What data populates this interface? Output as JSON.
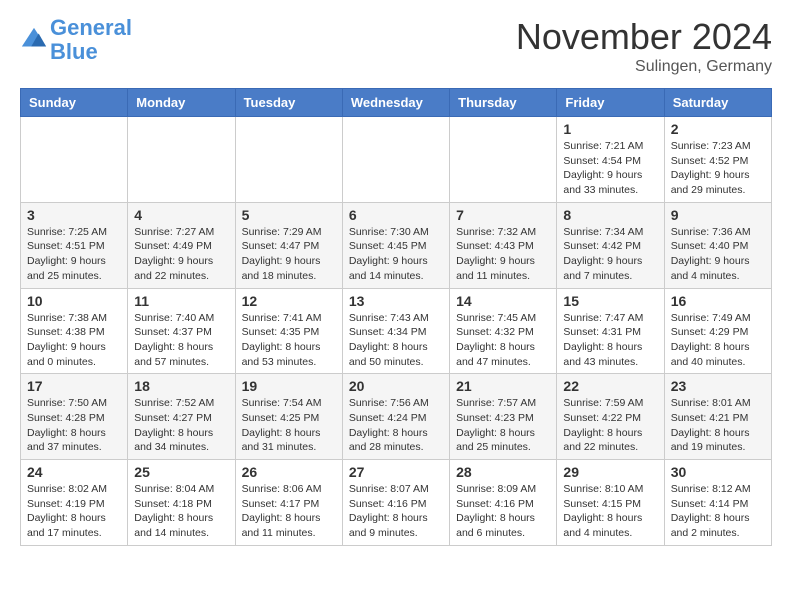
{
  "header": {
    "logo_line1": "General",
    "logo_line2": "Blue",
    "month": "November 2024",
    "location": "Sulingen, Germany"
  },
  "weekdays": [
    "Sunday",
    "Monday",
    "Tuesday",
    "Wednesday",
    "Thursday",
    "Friday",
    "Saturday"
  ],
  "weeks": [
    [
      {
        "day": "",
        "info": ""
      },
      {
        "day": "",
        "info": ""
      },
      {
        "day": "",
        "info": ""
      },
      {
        "day": "",
        "info": ""
      },
      {
        "day": "",
        "info": ""
      },
      {
        "day": "1",
        "info": "Sunrise: 7:21 AM\nSunset: 4:54 PM\nDaylight: 9 hours and 33 minutes."
      },
      {
        "day": "2",
        "info": "Sunrise: 7:23 AM\nSunset: 4:52 PM\nDaylight: 9 hours and 29 minutes."
      }
    ],
    [
      {
        "day": "3",
        "info": "Sunrise: 7:25 AM\nSunset: 4:51 PM\nDaylight: 9 hours and 25 minutes."
      },
      {
        "day": "4",
        "info": "Sunrise: 7:27 AM\nSunset: 4:49 PM\nDaylight: 9 hours and 22 minutes."
      },
      {
        "day": "5",
        "info": "Sunrise: 7:29 AM\nSunset: 4:47 PM\nDaylight: 9 hours and 18 minutes."
      },
      {
        "day": "6",
        "info": "Sunrise: 7:30 AM\nSunset: 4:45 PM\nDaylight: 9 hours and 14 minutes."
      },
      {
        "day": "7",
        "info": "Sunrise: 7:32 AM\nSunset: 4:43 PM\nDaylight: 9 hours and 11 minutes."
      },
      {
        "day": "8",
        "info": "Sunrise: 7:34 AM\nSunset: 4:42 PM\nDaylight: 9 hours and 7 minutes."
      },
      {
        "day": "9",
        "info": "Sunrise: 7:36 AM\nSunset: 4:40 PM\nDaylight: 9 hours and 4 minutes."
      }
    ],
    [
      {
        "day": "10",
        "info": "Sunrise: 7:38 AM\nSunset: 4:38 PM\nDaylight: 9 hours and 0 minutes."
      },
      {
        "day": "11",
        "info": "Sunrise: 7:40 AM\nSunset: 4:37 PM\nDaylight: 8 hours and 57 minutes."
      },
      {
        "day": "12",
        "info": "Sunrise: 7:41 AM\nSunset: 4:35 PM\nDaylight: 8 hours and 53 minutes."
      },
      {
        "day": "13",
        "info": "Sunrise: 7:43 AM\nSunset: 4:34 PM\nDaylight: 8 hours and 50 minutes."
      },
      {
        "day": "14",
        "info": "Sunrise: 7:45 AM\nSunset: 4:32 PM\nDaylight: 8 hours and 47 minutes."
      },
      {
        "day": "15",
        "info": "Sunrise: 7:47 AM\nSunset: 4:31 PM\nDaylight: 8 hours and 43 minutes."
      },
      {
        "day": "16",
        "info": "Sunrise: 7:49 AM\nSunset: 4:29 PM\nDaylight: 8 hours and 40 minutes."
      }
    ],
    [
      {
        "day": "17",
        "info": "Sunrise: 7:50 AM\nSunset: 4:28 PM\nDaylight: 8 hours and 37 minutes."
      },
      {
        "day": "18",
        "info": "Sunrise: 7:52 AM\nSunset: 4:27 PM\nDaylight: 8 hours and 34 minutes."
      },
      {
        "day": "19",
        "info": "Sunrise: 7:54 AM\nSunset: 4:25 PM\nDaylight: 8 hours and 31 minutes."
      },
      {
        "day": "20",
        "info": "Sunrise: 7:56 AM\nSunset: 4:24 PM\nDaylight: 8 hours and 28 minutes."
      },
      {
        "day": "21",
        "info": "Sunrise: 7:57 AM\nSunset: 4:23 PM\nDaylight: 8 hours and 25 minutes."
      },
      {
        "day": "22",
        "info": "Sunrise: 7:59 AM\nSunset: 4:22 PM\nDaylight: 8 hours and 22 minutes."
      },
      {
        "day": "23",
        "info": "Sunrise: 8:01 AM\nSunset: 4:21 PM\nDaylight: 8 hours and 19 minutes."
      }
    ],
    [
      {
        "day": "24",
        "info": "Sunrise: 8:02 AM\nSunset: 4:19 PM\nDaylight: 8 hours and 17 minutes."
      },
      {
        "day": "25",
        "info": "Sunrise: 8:04 AM\nSunset: 4:18 PM\nDaylight: 8 hours and 14 minutes."
      },
      {
        "day": "26",
        "info": "Sunrise: 8:06 AM\nSunset: 4:17 PM\nDaylight: 8 hours and 11 minutes."
      },
      {
        "day": "27",
        "info": "Sunrise: 8:07 AM\nSunset: 4:16 PM\nDaylight: 8 hours and 9 minutes."
      },
      {
        "day": "28",
        "info": "Sunrise: 8:09 AM\nSunset: 4:16 PM\nDaylight: 8 hours and 6 minutes."
      },
      {
        "day": "29",
        "info": "Sunrise: 8:10 AM\nSunset: 4:15 PM\nDaylight: 8 hours and 4 minutes."
      },
      {
        "day": "30",
        "info": "Sunrise: 8:12 AM\nSunset: 4:14 PM\nDaylight: 8 hours and 2 minutes."
      }
    ]
  ]
}
